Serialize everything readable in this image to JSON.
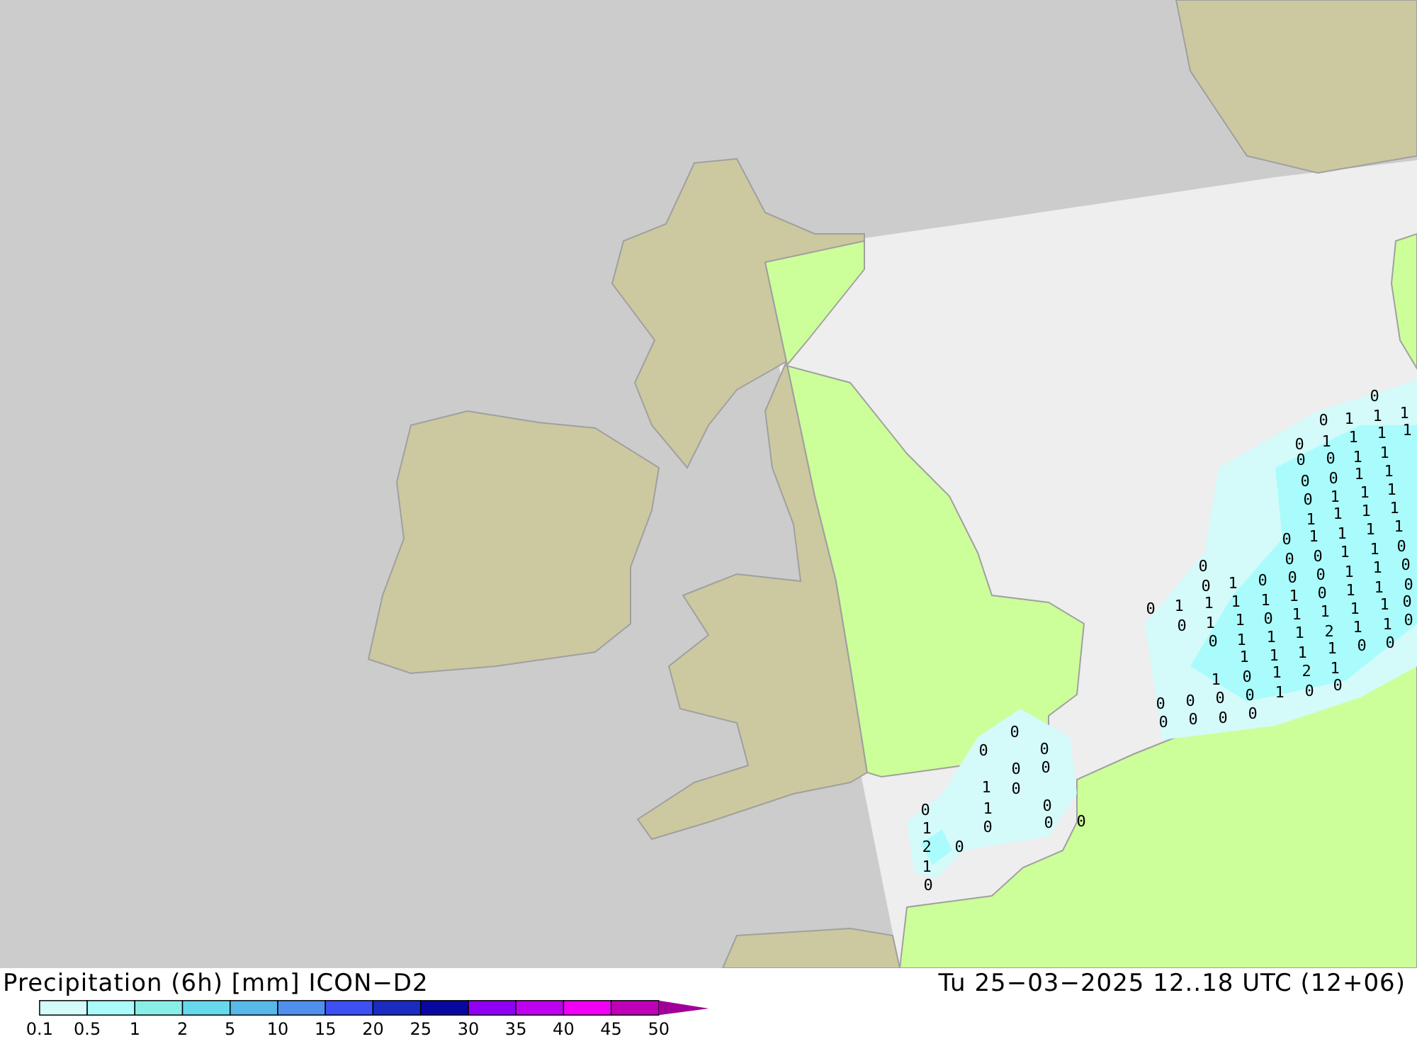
{
  "map": {
    "value_label_rows": [
      [
        "0"
      ],
      [
        "0",
        "1",
        "1",
        "1"
      ],
      [
        "0",
        "1",
        "1",
        "1",
        "1"
      ],
      [
        "0",
        "0",
        "1",
        "1"
      ],
      [
        "0",
        "0",
        "1",
        "1"
      ],
      [
        "0",
        "1",
        "1",
        "1"
      ],
      [
        "1",
        "1",
        "1",
        "1"
      ],
      [
        "0",
        "1",
        "1",
        "1",
        "1"
      ],
      [
        "0",
        "0",
        "1",
        "1",
        "0"
      ],
      [
        "0",
        "0",
        "0",
        "1",
        "1",
        "0"
      ],
      [
        "0",
        "1",
        "0",
        "0",
        "1",
        "1",
        "0"
      ],
      [
        "0",
        "1",
        "1",
        "1",
        "1",
        "1",
        "0"
      ],
      [
        "0",
        "1",
        "1",
        "0",
        "1",
        "1",
        "1",
        "1",
        "0"
      ],
      [
        "0",
        "1",
        "1",
        "1",
        "2",
        "1",
        "1"
      ],
      [
        "1",
        "1",
        "1",
        "1",
        "0",
        "0"
      ],
      [
        "1",
        "0",
        "1",
        "2",
        "1"
      ],
      [
        "0",
        "0",
        "0",
        "0",
        "1",
        "0",
        "0"
      ],
      [
        "0",
        "0",
        "0",
        "0"
      ],
      [
        "0"
      ],
      [
        "0",
        "0"
      ],
      [
        "0",
        "0"
      ],
      [
        "1",
        "0"
      ],
      [
        "0",
        "1",
        "0"
      ],
      [
        "1",
        "0",
        "0",
        "0"
      ],
      [
        "2",
        "0"
      ],
      [
        "1"
      ],
      [
        "0"
      ]
    ]
  },
  "legend": {
    "title": "Precipitation (6h) [mm] ICON−D2",
    "valid_time": "Tu 25−03−2025 12..18 UTC (12+06)",
    "bins": [
      {
        "color": "#d4fafa"
      },
      {
        "color": "#aafcfc"
      },
      {
        "color": "#8aeee8"
      },
      {
        "color": "#68d8ec"
      },
      {
        "color": "#58b8e8"
      },
      {
        "color": "#5090ec"
      },
      {
        "color": "#3c50f4"
      },
      {
        "color": "#1c2cc0"
      },
      {
        "color": "#0808a0"
      },
      {
        "color": "#9000f4"
      },
      {
        "color": "#c000f0"
      },
      {
        "color": "#f000f4"
      },
      {
        "color": "#c000b8"
      }
    ],
    "overflow": {
      "color": "#a00098"
    },
    "ticks": [
      "0.1",
      "0.5",
      "1",
      "2",
      "5",
      "10",
      "15",
      "20",
      "25",
      "30",
      "35",
      "40",
      "45",
      "50"
    ]
  }
}
